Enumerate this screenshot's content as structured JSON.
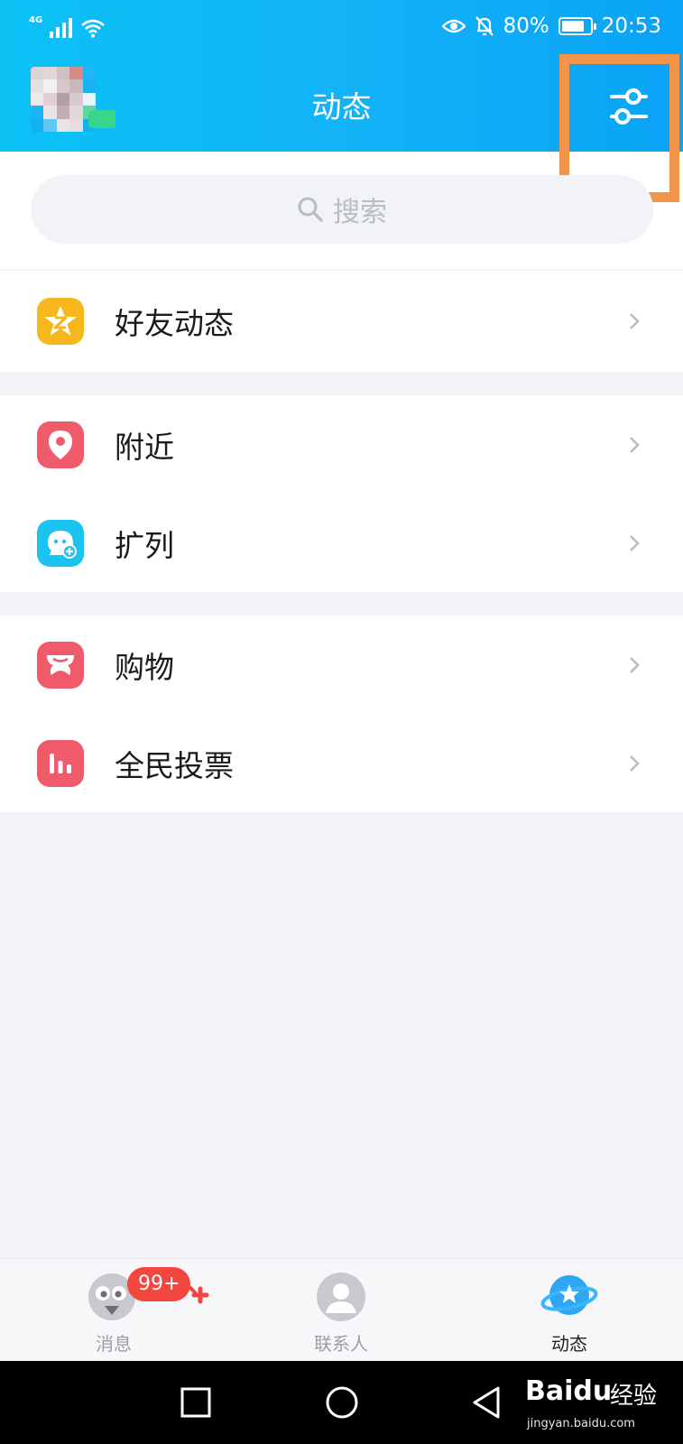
{
  "status_bar": {
    "network": "4G",
    "battery": "80%",
    "battery_level": 0.8,
    "time": "20:53"
  },
  "header": {
    "title": "动态",
    "filter_icon": "sliders-icon"
  },
  "search": {
    "placeholder": "搜索"
  },
  "groups": [
    {
      "items": [
        {
          "label": "好友动态",
          "icon": "qzone-star-icon",
          "color": "#f6b81c"
        }
      ]
    },
    {
      "items": [
        {
          "label": "附近",
          "icon": "location-pin-icon",
          "color": "#f05b6b"
        },
        {
          "label": "扩列",
          "icon": "face-plus-icon",
          "color": "#1bc3f0"
        }
      ]
    },
    {
      "items": [
        {
          "label": "购物",
          "icon": "shopping-bow-icon",
          "color": "#f05b6b"
        },
        {
          "label": "全民投票",
          "icon": "vote-chart-icon",
          "color": "#f05b6b"
        }
      ]
    }
  ],
  "tabbar": {
    "tabs": [
      {
        "label": "消息",
        "icon": "penguin-chat-icon"
      },
      {
        "label": "联系人",
        "icon": "contact-person-icon"
      },
      {
        "label": "动态",
        "icon": "planet-star-icon",
        "active": true
      }
    ],
    "badge": "99+"
  },
  "system_nav": {
    "recent": "square-icon",
    "home": "circle-icon",
    "back": "triangle-back-icon"
  },
  "watermark": {
    "logo": "Baidu",
    "tag": "经验",
    "url": "jingyan.baidu.com"
  }
}
